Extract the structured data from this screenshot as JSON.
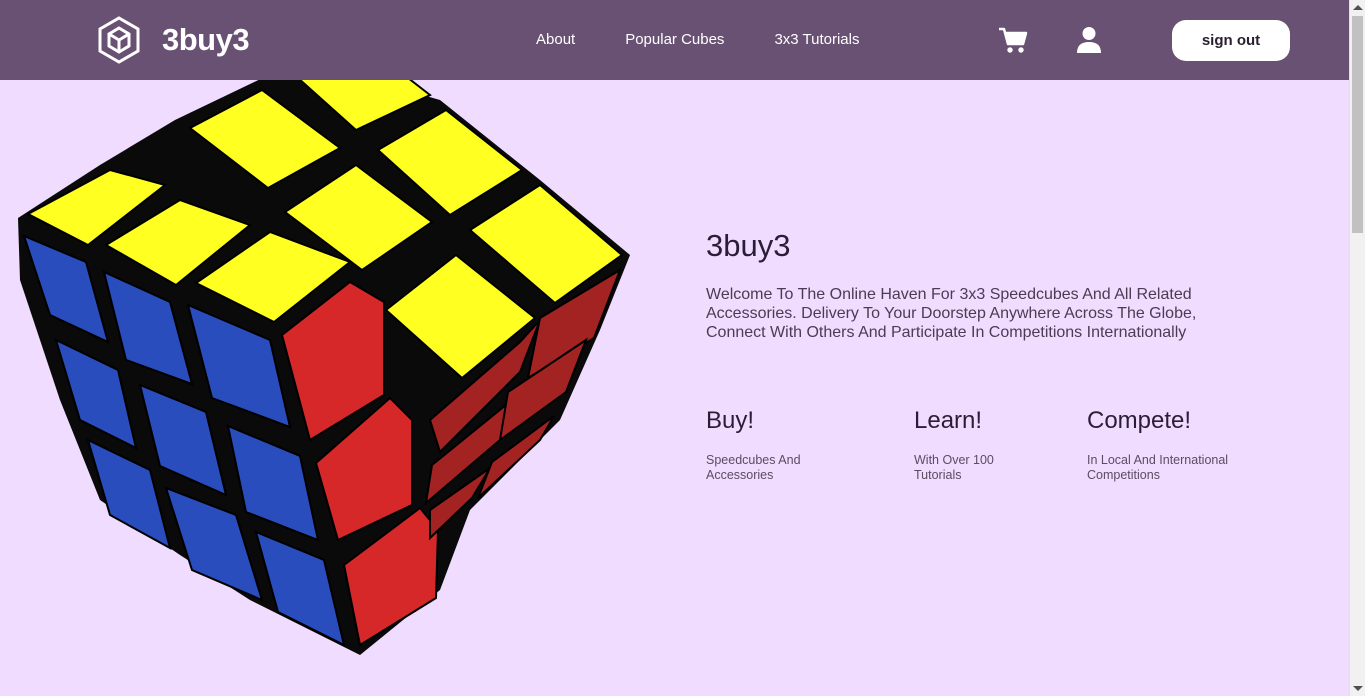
{
  "header": {
    "brand_name": "3buy3",
    "nav": {
      "about": "About",
      "popular": "Popular Cubes",
      "tutorials": "3x3 Tutorials"
    },
    "signout_label": "sign out"
  },
  "hero": {
    "title": "3buy3",
    "description": "Welcome To The Online Haven For 3x3 Speedcubes And All Related Accessories. Delivery To Your Doorstep Anywhere Across The Globe, Connect With Others And Participate In Competitions Internationally"
  },
  "features": [
    {
      "title": "Buy!",
      "text": "Speedcubes And Accessories"
    },
    {
      "title": "Learn!",
      "text": "With Over 100 Tutorials"
    },
    {
      "title": "Compete!",
      "text": "In Local And International Competitions"
    }
  ],
  "colors": {
    "header_bg": "#695173",
    "page_bg": "#f0dcff",
    "cube_yellow": "#ffff22",
    "cube_blue": "#2a4dbd",
    "cube_red": "#d62828",
    "cube_dark_red": "#a32222"
  },
  "icons": {
    "logo": "cube-logo-icon",
    "cart": "cart-icon",
    "user": "user-icon"
  }
}
